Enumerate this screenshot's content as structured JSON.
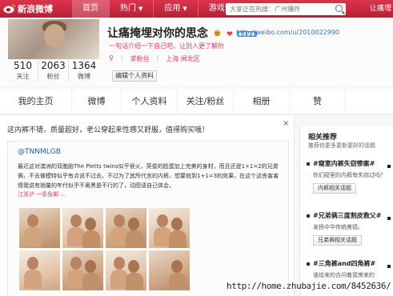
{
  "topbar": {
    "logo_text": "新浪微博",
    "nav": [
      {
        "label": "首页",
        "dropdown": false
      },
      {
        "label": "热门",
        "dropdown": true
      },
      {
        "label": "应用",
        "dropdown": true
      },
      {
        "label": "游戏",
        "dropdown": true
      }
    ],
    "search_placeholder": "大家正在热搜：广州爆炸",
    "user_link": "让痛埋"
  },
  "profile": {
    "name": "让痛掩埋对你的思念",
    "url": "http://weibo.com/u/2010022990",
    "motto": "一句话介绍一下自己吧，让别人更了解你",
    "gender": "♀",
    "follow_label": "求粉丝",
    "location": "上海 闸北区",
    "edit_button": "编辑个人资料",
    "stats": [
      {
        "value": "510",
        "label": "关注"
      },
      {
        "value": "2063",
        "label": "粉丝"
      },
      {
        "value": "1364",
        "label": "微博"
      }
    ]
  },
  "tabs": [
    "我的主页",
    "微博",
    "个人资料",
    "关注/粉丝",
    "相册",
    "赞"
  ],
  "feed": {
    "intro": "这内裤不错，质量超好，老公穿起来性感又舒服，值得购买哦！",
    "close": "×",
    "post": {
      "user": "@TNNMLGB",
      "text": "最近这对澳洲的双胞胎The Pletts twins似乎很火，英俊的脸蛋加上完美的身材，而且还是1+1=2的兄弟俩，不去做模特似乎有点说不过去。不过为了其所代言的内裤，想要就到1+1=3的效果，在这个这丧害害情我说有销量的年代似乎不奥黑是不行的了，动图请自己体会，",
      "link": "江浙沪 一条免邮 ..."
    }
  },
  "sidebar": {
    "title": "相关推荐",
    "desc": "推荐你更多更新更好的话题",
    "topics": [
      {
        "title": "#窥室内裤失窃惨案#",
        "desc": "你们窥室的内裤有失窃过吗？",
        "button": "内裤相关话题"
      },
      {
        "title": "#兄弟俩三度割皮救父#",
        "desc": "发扬中华传统美德。",
        "button": "兄弟俩相关话题"
      },
      {
        "title": "#三角裤and四角裤#",
        "desc": "谁给来的合问着篮席来的",
        "button": ""
      }
    ]
  },
  "watermark": "http://home.zhubajie.com/8452636/"
}
